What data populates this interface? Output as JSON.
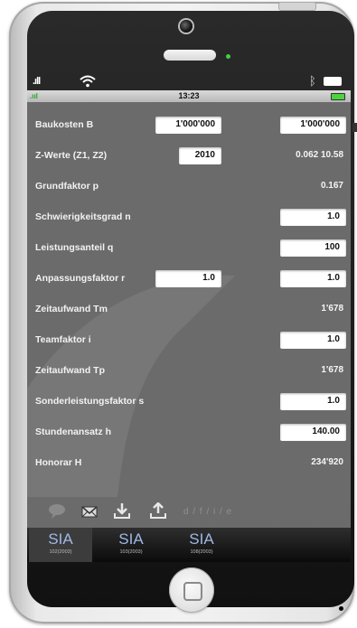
{
  "status": {
    "time": "13:23",
    "carrier_signal": ".ııl"
  },
  "rows": [
    {
      "label": "Baukosten B",
      "input_left": "1'000'000",
      "input_right": "1'000'000"
    },
    {
      "label": "Z-Werte (Z1, Z2)",
      "input_left": "2010",
      "value_right": "0.062  10.58"
    },
    {
      "label": "Grundfaktor p",
      "value_right": "0.167"
    },
    {
      "label": "Schwierigkeitsgrad n",
      "input_right": "1.0"
    },
    {
      "label": "Leistungsanteil q",
      "input_right": "100"
    },
    {
      "label": "Anpassungsfaktor r",
      "input_left": "1.0",
      "input_right": "1.0"
    },
    {
      "label": "Zeitaufwand Tm",
      "value_right": "1'678"
    },
    {
      "label": "Teamfaktor i",
      "input_right": "1.0"
    },
    {
      "label": "Zeitaufwand Tp",
      "value_right": "1'678"
    },
    {
      "label": "Sonderleistungsfaktor s",
      "input_right": "1.0"
    },
    {
      "label": "Stundenansatz h",
      "input_right": "140.00"
    },
    {
      "label": "Honorar H",
      "value_right": "234'920"
    }
  ],
  "toolbar": {
    "lang_text": "d / f / i / e",
    "icons": [
      "speech-bubble-icon",
      "mail-icon",
      "download-icon",
      "upload-icon"
    ]
  },
  "tabs": [
    {
      "title": "SIA",
      "subtitle": "102(2003)"
    },
    {
      "title": "SIA",
      "subtitle": "103(2003)"
    },
    {
      "title": "SIA",
      "subtitle": "108(2003)"
    }
  ],
  "colors": {
    "screen_bg": "#6b6b6b",
    "tab_active_text": "#9fb8e6",
    "battery_green": "#49d33e"
  }
}
